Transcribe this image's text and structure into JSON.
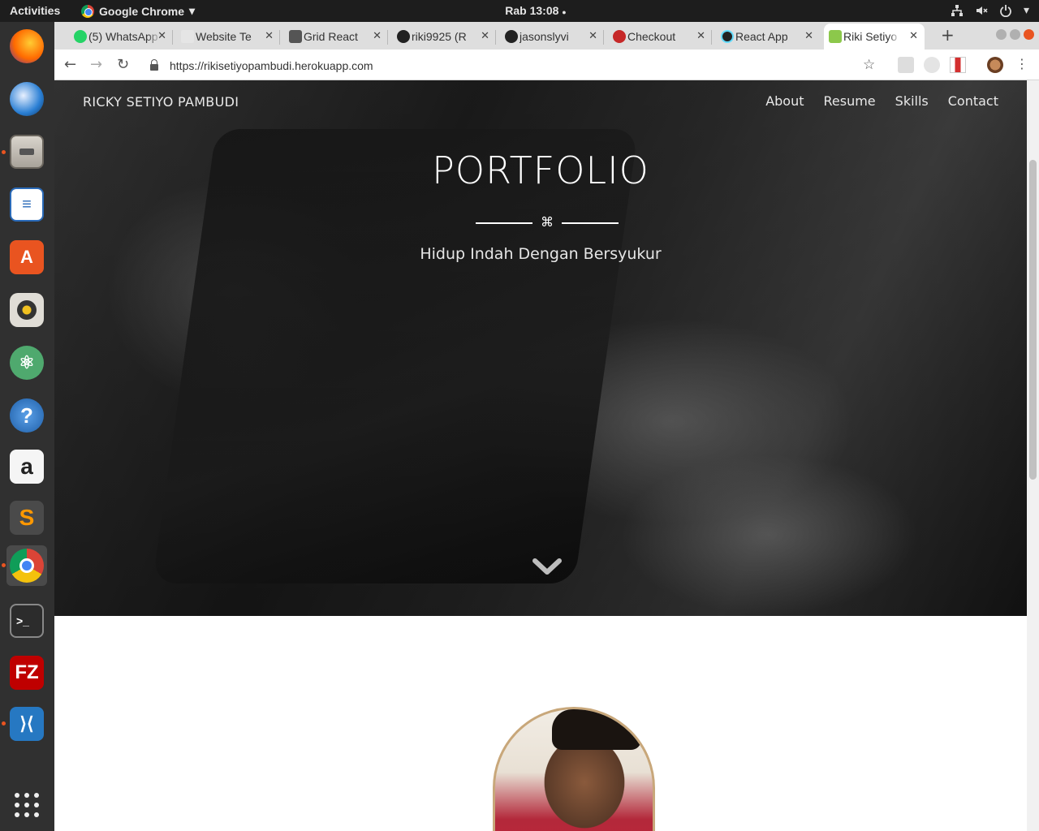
{
  "topbar": {
    "activities": "Activities",
    "app_name": "Google Chrome",
    "clock": "Rab 13:08"
  },
  "dock": {
    "items": [
      "firefox",
      "thunderbird",
      "files",
      "libreoffice-writer",
      "ubuntu-software",
      "rhythmbox",
      "atom",
      "help",
      "amazon",
      "sublime-text",
      "google-chrome",
      "terminal",
      "filezilla",
      "vscode",
      "show-applications"
    ]
  },
  "browser": {
    "tabs": [
      {
        "title": "(5) WhatsApp"
      },
      {
        "title": "Website Te"
      },
      {
        "title": "Grid React"
      },
      {
        "title": "riki9925 (R"
      },
      {
        "title": "jasonslyvi"
      },
      {
        "title": "Checkout"
      },
      {
        "title": "React App"
      },
      {
        "title": "Riki Setiyo"
      }
    ],
    "url": "https://rikisetiyopambudi.herokuapp.com"
  },
  "site": {
    "brand": "RICKY SETIYO PAMBUDI",
    "nav": [
      "About",
      "Resume",
      "Skills",
      "Contact"
    ],
    "hero_title": "PORTFOLIO",
    "divider_symbol": "⌘",
    "hero_subtitle": "Hidup Indah Dengan Bersyukur"
  },
  "colors": {
    "accent": "#e95420",
    "avatar_border": "#c8a77a"
  }
}
